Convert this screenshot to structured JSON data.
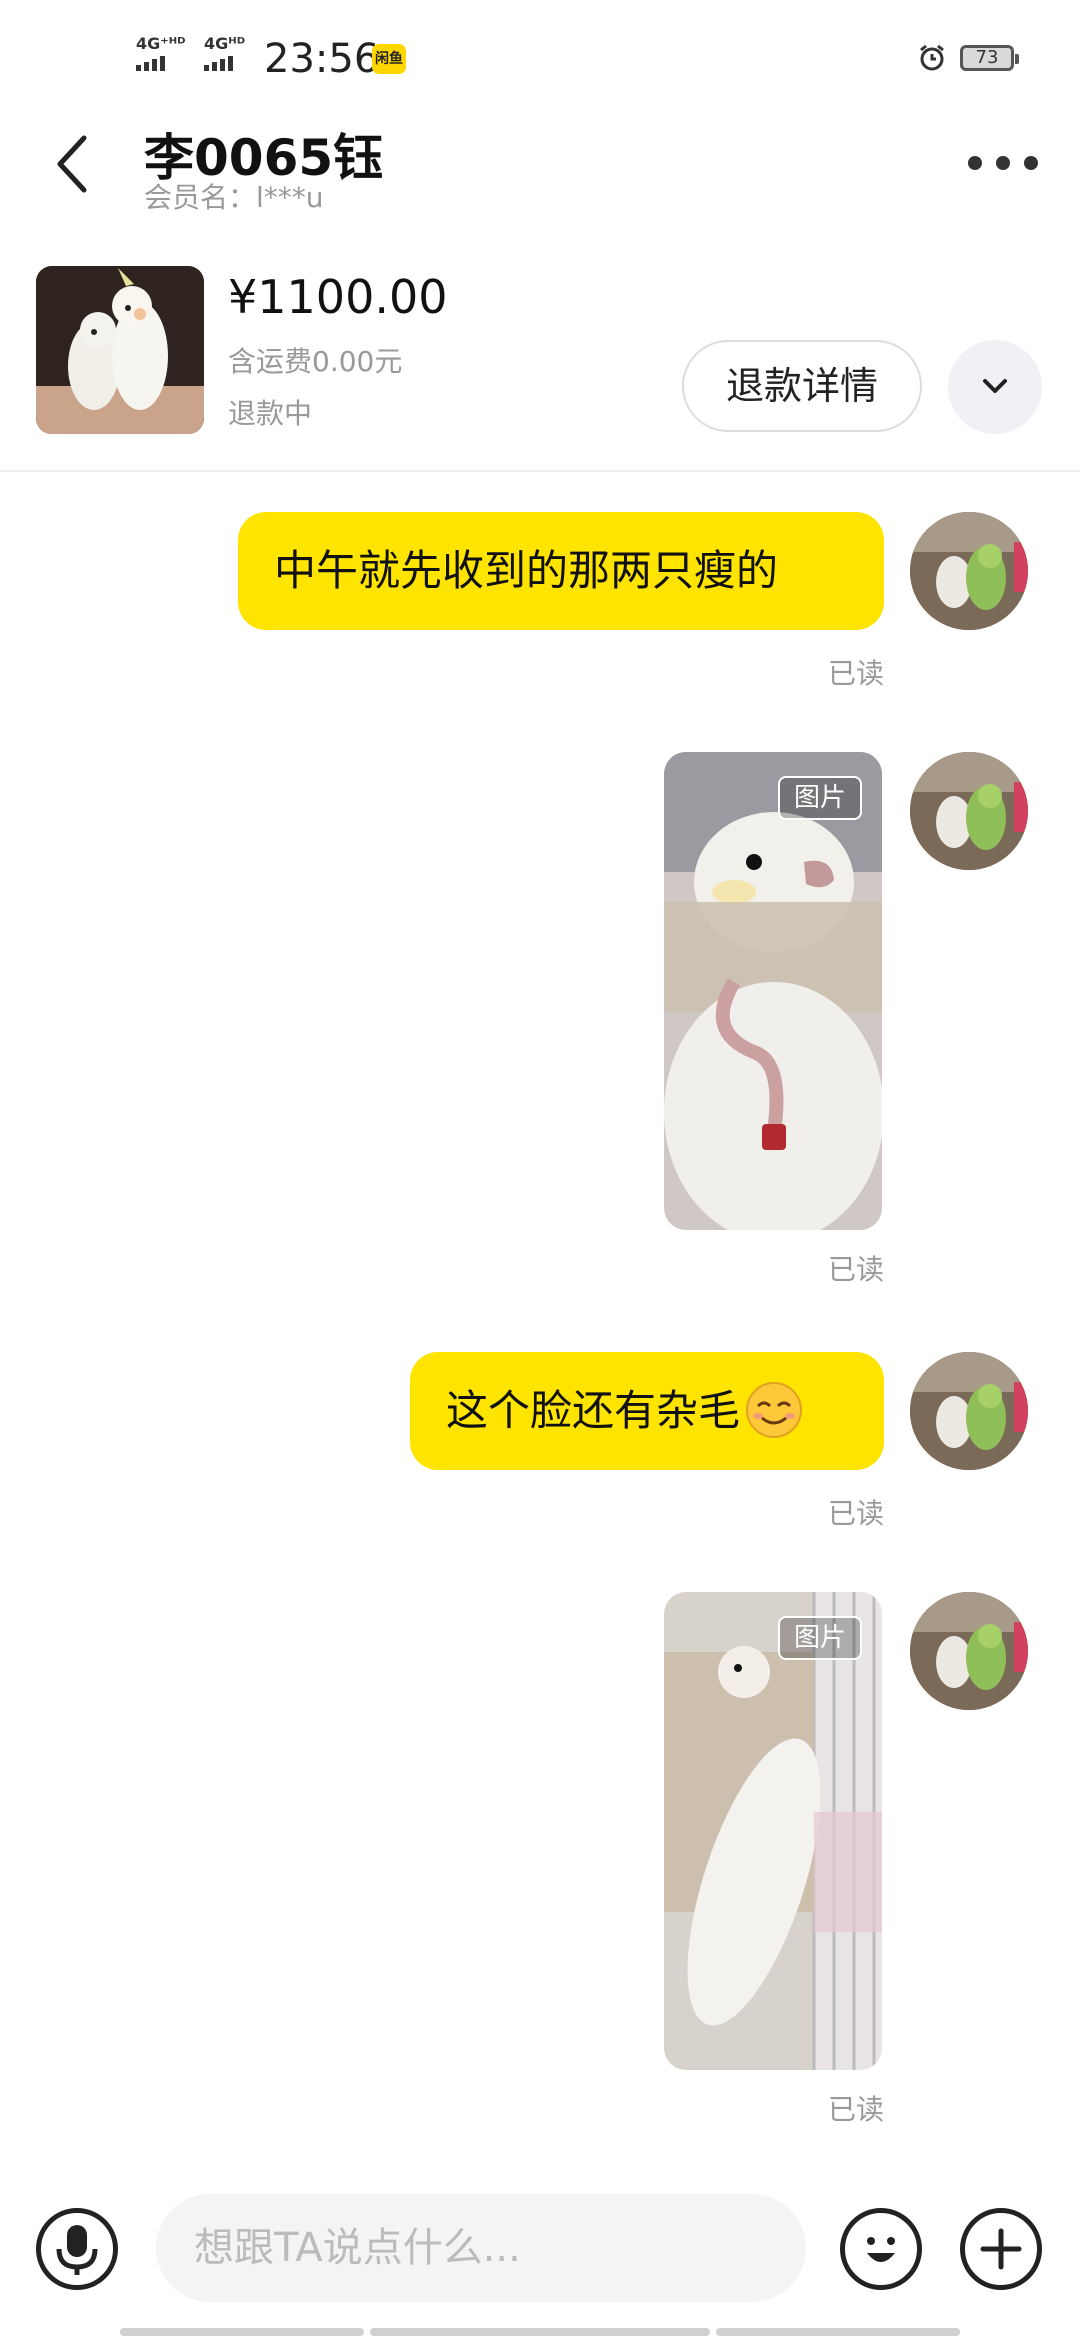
{
  "status_bar": {
    "sim1": "4G⁺ᴴᴰ",
    "sim2": "4Gᴴᴰ",
    "time": "23:56",
    "battery": "73"
  },
  "header": {
    "title": "李0065钰",
    "member_name": "会员名：l***u"
  },
  "product": {
    "price": "¥1100.00",
    "shipping": "含运费0.00元",
    "status": "退款中",
    "refund_button": "退款详情"
  },
  "messages": [
    {
      "type": "text",
      "text": "中午就先收到的那两只瘦的",
      "read": "已读"
    },
    {
      "type": "image",
      "tag": "图片",
      "read": "已读"
    },
    {
      "type": "text",
      "text": "这个脸还有杂毛",
      "read": "已读"
    },
    {
      "type": "image",
      "tag": "图片",
      "read": "已读"
    }
  ],
  "input": {
    "placeholder": "想跟TA说点什么..."
  },
  "icons": [
    "back-arrow-icon",
    "more-icon",
    "chevron-down-icon",
    "microphone-icon",
    "emoji-icon",
    "plus-icon",
    "alarm-icon"
  ],
  "colors": {
    "bubble": "#ffe400",
    "read_text": "#999999"
  }
}
